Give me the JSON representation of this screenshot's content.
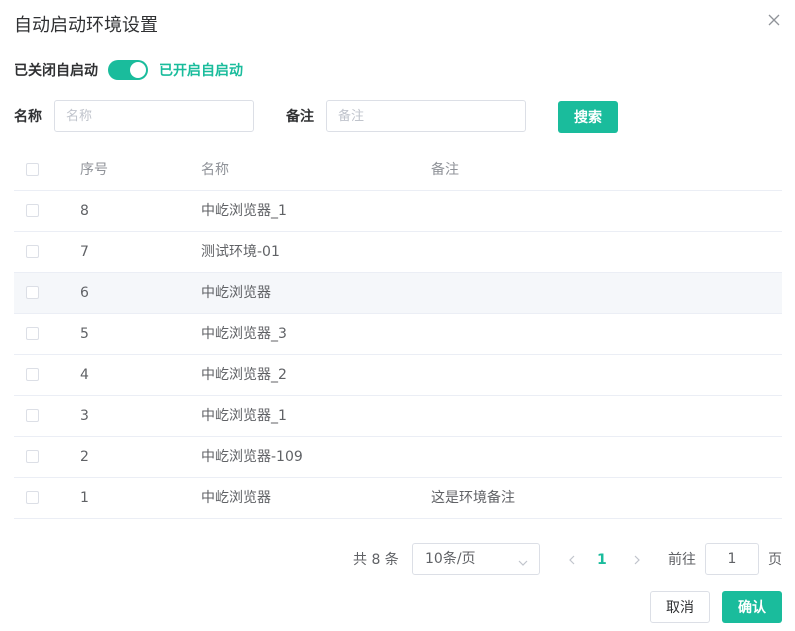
{
  "dialog": {
    "title": "自动启动环境设置"
  },
  "switch": {
    "off_label": "已关闭自启动",
    "on_label": "已开启自启动",
    "checked": true
  },
  "filters": {
    "name_label": "名称",
    "name_placeholder": "名称",
    "name_value": "",
    "note_label": "备注",
    "note_placeholder": "备注",
    "note_value": "",
    "search_label": "搜索"
  },
  "table": {
    "headers": {
      "index": "序号",
      "name": "名称",
      "note": "备注"
    },
    "rows": [
      {
        "index": "8",
        "name": "中屹浏览器_1",
        "note": ""
      },
      {
        "index": "7",
        "name": "测试环境-01",
        "note": ""
      },
      {
        "index": "6",
        "name": "中屹浏览器",
        "note": ""
      },
      {
        "index": "5",
        "name": "中屹浏览器_3",
        "note": ""
      },
      {
        "index": "4",
        "name": "中屹浏览器_2",
        "note": ""
      },
      {
        "index": "3",
        "name": "中屹浏览器_1",
        "note": ""
      },
      {
        "index": "2",
        "name": "中屹浏览器-109",
        "note": ""
      },
      {
        "index": "1",
        "name": "中屹浏览器",
        "note": "这是环境备注"
      }
    ],
    "hover_row": 2
  },
  "pagination": {
    "total_text": "共 8 条",
    "page_size": "10条/页",
    "current_page": "1",
    "goto_label": "前往",
    "goto_value": "1",
    "goto_suffix": "页"
  },
  "footer": {
    "cancel_label": "取消",
    "confirm_label": "确认"
  },
  "colors": {
    "accent": "#1abc9c",
    "text": "#303133",
    "muted": "#909399",
    "border": "#dcdfe6",
    "row_hover": "#f5f7fa"
  },
  "icons": {
    "close": "close-icon",
    "prev": "chevron-left-icon",
    "next": "chevron-right-icon",
    "dropdown": "chevron-down-icon"
  }
}
